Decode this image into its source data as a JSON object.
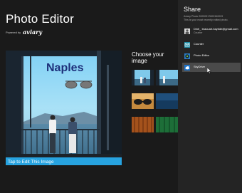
{
  "app": {
    "title": "Photo Editor",
    "powered_by": "Powered by",
    "brand": "aviary"
  },
  "photo": {
    "title_text": "Naples",
    "caption": "Tap to Edit This Image"
  },
  "choose": {
    "title": "Choose your image"
  },
  "share": {
    "title": "Share",
    "description_line1": "Aviary Photo 20090917802340029",
    "description_line2": "This is your most recently edited photo.",
    "items": [
      {
        "label": "Dinh_ bracuart.baytide@gmail.com",
        "sublabel": "Counter",
        "icon": "contact-icon"
      },
      {
        "label": "Counter",
        "icon": "mail-icon"
      },
      {
        "label": "Photo Editor",
        "icon": "photo-editor-icon"
      },
      {
        "label": "SkyDrive",
        "icon": "skydrive-icon"
      }
    ]
  },
  "colors": {
    "accent": "#27a3e0",
    "panel_bg": "#242424",
    "app_bg": "#1a1a1a",
    "selected": "#4a4a4a"
  }
}
